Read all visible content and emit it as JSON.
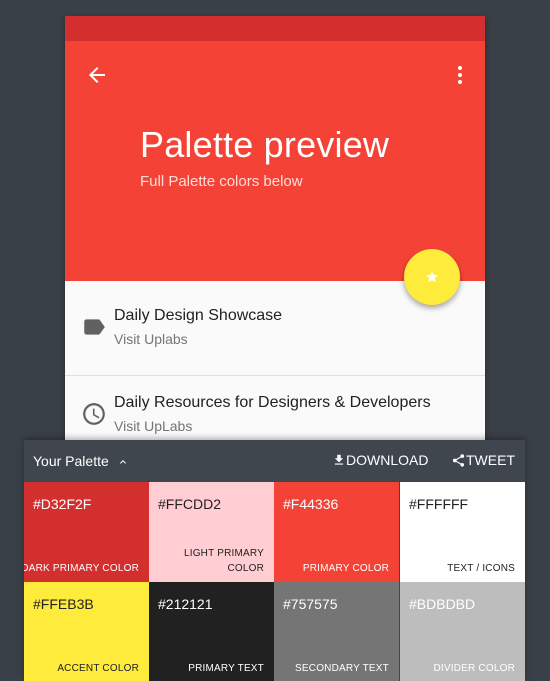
{
  "colors": {
    "background": "#3a4047",
    "status_bar": "#D32F2F",
    "app_bar": "#F44336",
    "fab": "#FFEB3B",
    "panel": "#3f464e"
  },
  "app": {
    "title": "Palette preview",
    "subtitle": "Full Palette colors below",
    "back_icon": "arrow-back-icon",
    "more_icon": "more-vert-icon",
    "fab_icon": "star-icon"
  },
  "list": {
    "items": [
      {
        "icon": "label-icon",
        "title": "Daily Design Showcase",
        "subtitle": "Visit Uplabs"
      },
      {
        "icon": "clock-icon",
        "title": "Daily Resources for Designers & Developers",
        "subtitle": "Visit UpLabs"
      }
    ]
  },
  "palette_panel": {
    "title": "Your Palette",
    "download_label": "DOWNLOAD",
    "tweet_label": "TWEET",
    "swatches": [
      {
        "hex": "#D32F2F",
        "role": "DARK PRIMARY COLOR",
        "color": "#D32F2F",
        "text_color": "#ffffff"
      },
      {
        "hex": "#FFCDD2",
        "role": "LIGHT PRIMARY COLOR",
        "color": "#FFCDD2",
        "text_color": "#212121"
      },
      {
        "hex": "#F44336",
        "role": "PRIMARY COLOR",
        "color": "#F44336",
        "text_color": "#ffffff"
      },
      {
        "hex": "#FFFFFF",
        "role": "TEXT / ICONS",
        "color": "#FFFFFF",
        "text_color": "#212121"
      },
      {
        "hex": "#FFEB3B",
        "role": "ACCENT COLOR",
        "color": "#FFEB3B",
        "text_color": "#212121"
      },
      {
        "hex": "#212121",
        "role": "PRIMARY TEXT",
        "color": "#212121",
        "text_color": "#ffffff"
      },
      {
        "hex": "#757575",
        "role": "SECONDARY TEXT",
        "color": "#757575",
        "text_color": "#ffffff"
      },
      {
        "hex": "#BDBDBD",
        "role": "DIVIDER COLOR",
        "color": "#BDBDBD",
        "text_color": "#ffffff"
      }
    ]
  }
}
